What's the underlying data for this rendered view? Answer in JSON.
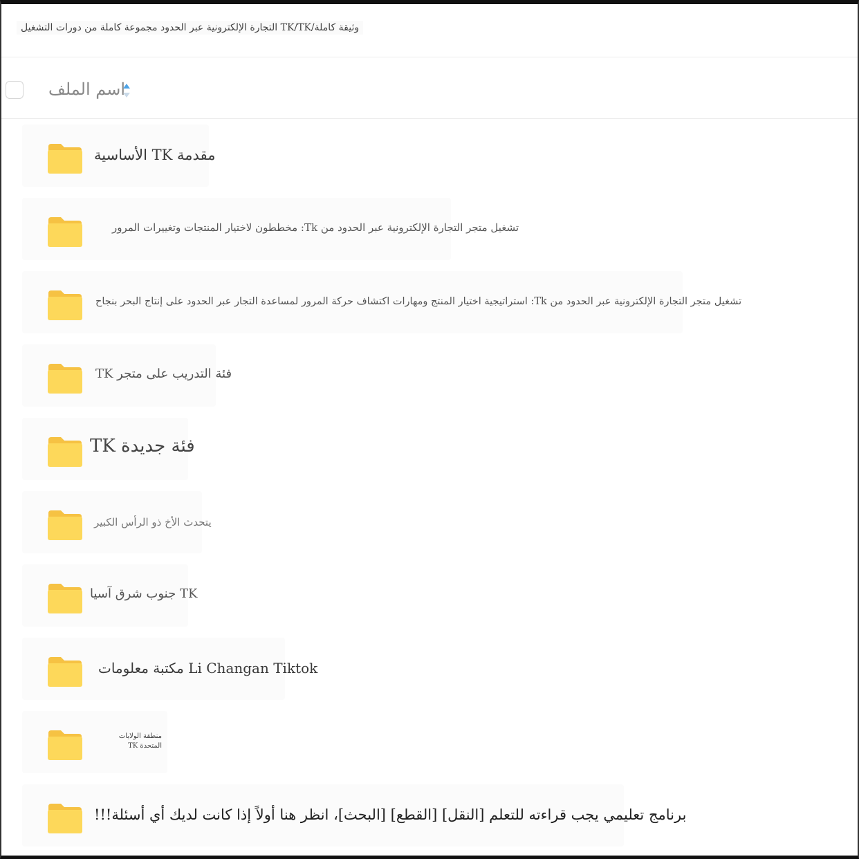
{
  "breadcrumb": {
    "path": "وثيقة كاملة/TK/TK التجارة الإلكترونية عبر الحدود مجموعة كاملة من دورات التشغيل"
  },
  "header": {
    "column_label": "اسم الملف"
  },
  "files": [
    {
      "name": "مقدمة TK الأساسية",
      "icon": "folder-icon"
    },
    {
      "name": "تشغيل متجر التجارة الإلكترونية عبر الحدود من Tk: مخططون لاختيار المنتجات وتغييرات المرور",
      "icon": "folder-icon"
    },
    {
      "name": "تشغيل متجر التجارة الإلكترونية عبر الحدود من Tk: استراتيجية اختيار المنتج ومهارات اكتشاف حركة المرور لمساعدة التجار عبر الحدود على إنتاج البحر بنجاح",
      "icon": "folder-icon"
    },
    {
      "name": "فئة التدريب على متجر TK",
      "icon": "folder-icon"
    },
    {
      "name": "فئة جديدة TK",
      "icon": "folder-icon"
    },
    {
      "name": "يتحدث الأخ ذو الرأس الكبير",
      "icon": "folder-icon"
    },
    {
      "name": "TK جنوب شرق آسيا",
      "icon": "folder-icon"
    },
    {
      "name": "Li Changan Tiktok مكتبة معلومات",
      "icon": "folder-icon"
    },
    {
      "name": "منطقة الولايات المتحدة TK",
      "icon": "folder-icon"
    },
    {
      "name": "برنامج تعليمي يجب قراءته للتعلم [النقل] [القطع] [البحث]، انظر هنا أولاً إذا كانت لديك أي أسئلة!!!",
      "icon": "folder-icon"
    }
  ],
  "colors": {
    "folder_fill": "#fdd85a",
    "folder_tab": "#f6c243",
    "sort_arrow": "#4da3e6"
  }
}
